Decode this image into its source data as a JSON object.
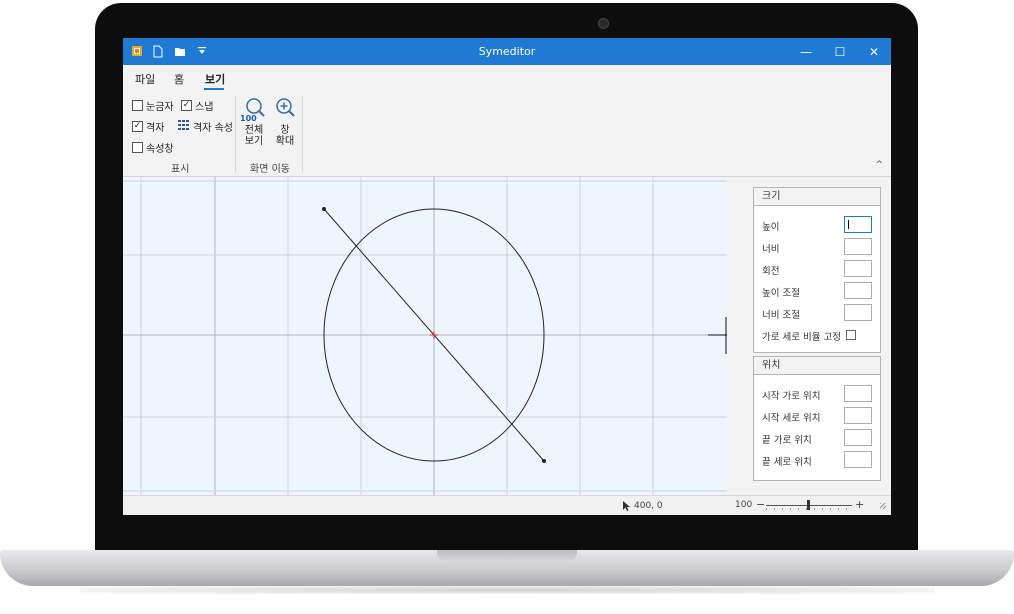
{
  "window": {
    "title": "Symeditor"
  },
  "window_controls": {
    "minimize": "—",
    "maximize": "☐",
    "close": "✕"
  },
  "menu": {
    "tabs": [
      "파일",
      "홈",
      "보기"
    ],
    "active_index": 2
  },
  "ribbon": {
    "display_group": {
      "label": "표시",
      "ruler": {
        "label": "눈금자",
        "checked": false
      },
      "snap": {
        "label": "스냅",
        "checked": true
      },
      "grid": {
        "label": "격자",
        "checked": true
      },
      "grid_props": {
        "label": "격자 속성"
      },
      "properties": {
        "label": "속성창",
        "checked": false
      }
    },
    "navigate_group": {
      "label": "화면 이동",
      "fit_all": {
        "line1": "전체",
        "line2": "보기",
        "badge": "100"
      },
      "zoom_in": {
        "line1": "창",
        "line2": "확대"
      }
    }
  },
  "properties": {
    "size": {
      "title": "크기",
      "height": "높이",
      "width": "너비",
      "rotation": "회전",
      "height_adjust": "높이 조절",
      "width_adjust": "너비 조절",
      "lock_ratio": "가로 세로 비율 고정"
    },
    "position": {
      "title": "위치",
      "start_x": "시작 가로 위치",
      "start_y": "시작 세로 위치",
      "end_x": "끝 가로 위치",
      "end_y": "끝 세로 위치"
    }
  },
  "status": {
    "cursor": "400, 0",
    "zoom": "100",
    "zoom_minus": "−",
    "zoom_plus": "+"
  },
  "colors": {
    "accent": "#1e7ad2",
    "canvas": "#eef5fe",
    "grid": "#c9d4e0"
  }
}
